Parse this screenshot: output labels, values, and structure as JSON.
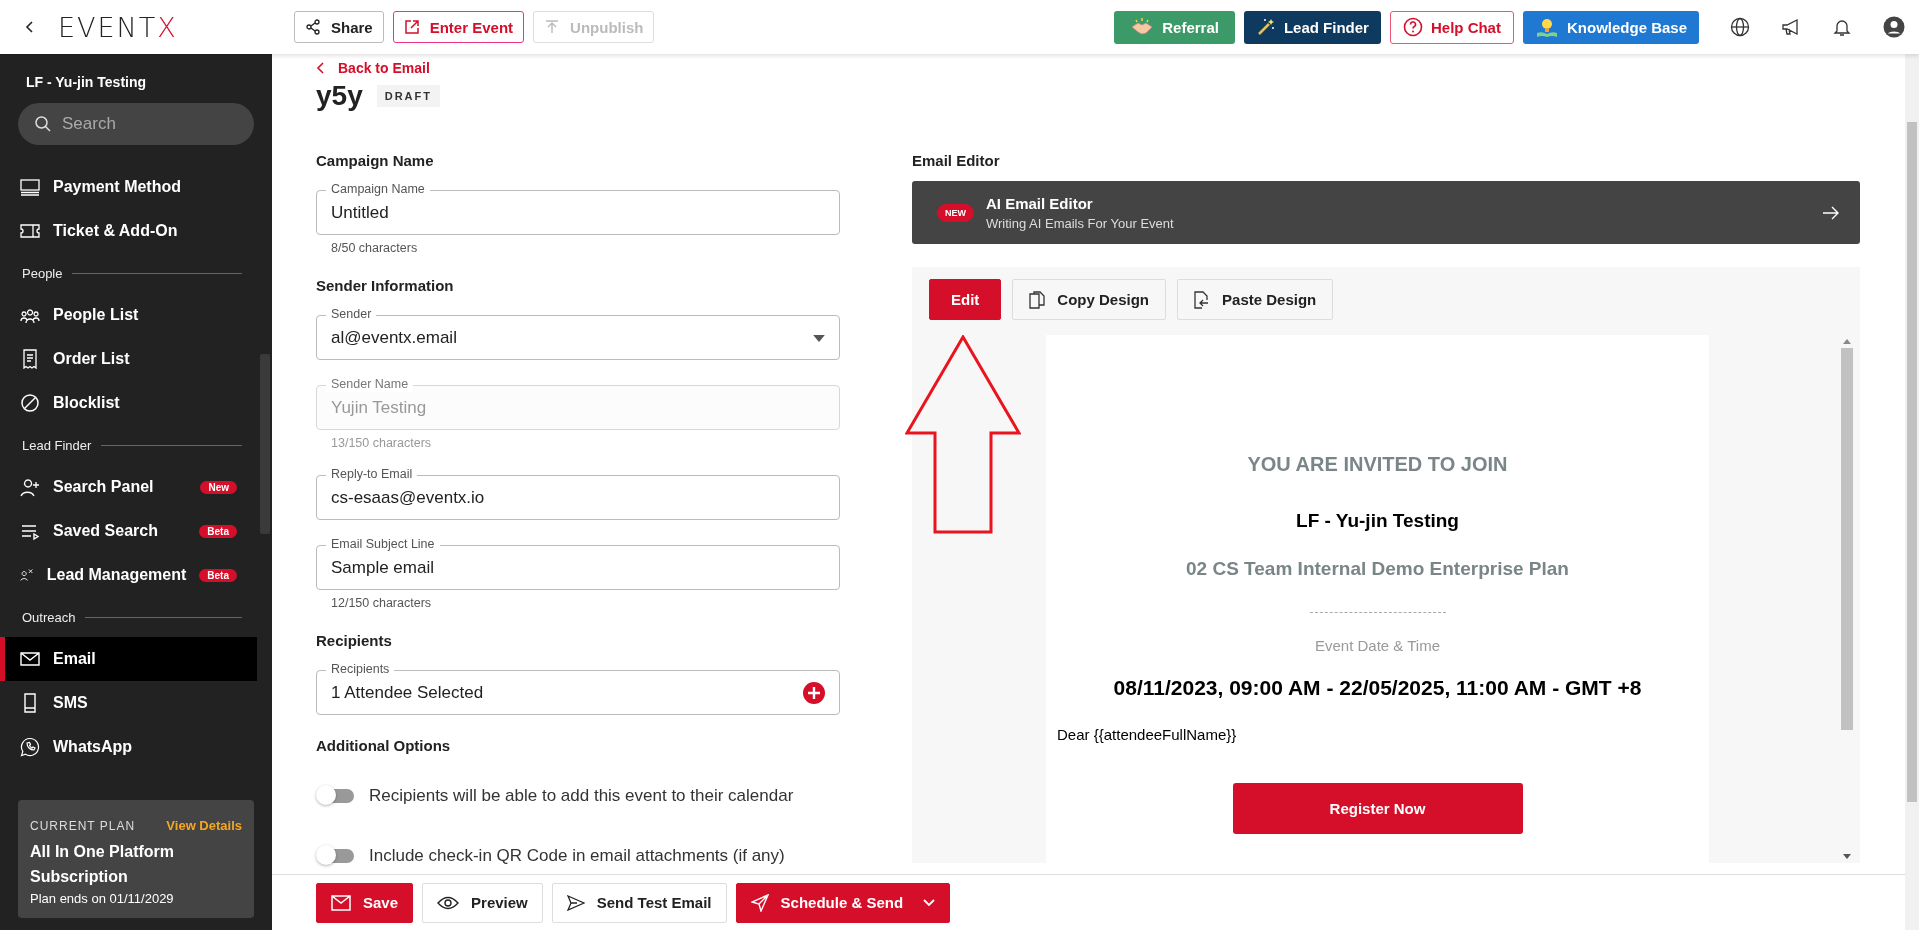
{
  "topbar": {
    "logo": {
      "main": "EVENT",
      "accent": "X"
    },
    "left_buttons": [
      {
        "label": "Share",
        "kind": "plain",
        "disabled": false
      },
      {
        "label": "Enter Event",
        "kind": "outline",
        "disabled": false
      },
      {
        "label": "Unpublish",
        "kind": "plain",
        "disabled": true
      }
    ],
    "right_buttons": [
      {
        "label": "Referral",
        "kind": "referral"
      },
      {
        "label": "Lead Finder",
        "kind": "lead"
      },
      {
        "label": "Help Chat",
        "kind": "help"
      },
      {
        "label": "Knowledge Base",
        "kind": "knowledge"
      }
    ]
  },
  "sidebar": {
    "event_name": "LF - Yu-jin Testing",
    "search": {
      "placeholder": "Search"
    },
    "items": [
      {
        "kind": "item",
        "label": "Payment Method",
        "selected": false
      },
      {
        "kind": "item",
        "label": "Ticket & Add-On",
        "selected": false
      },
      {
        "kind": "section",
        "label": "People"
      },
      {
        "kind": "item",
        "label": "People List",
        "selected": false
      },
      {
        "kind": "item",
        "label": "Order List",
        "selected": false
      },
      {
        "kind": "item",
        "label": "Blocklist",
        "selected": false
      },
      {
        "kind": "section",
        "label": "Lead Finder"
      },
      {
        "kind": "item",
        "label": "Search Panel",
        "badge": "New",
        "selected": false
      },
      {
        "kind": "item",
        "label": "Saved Search",
        "badge": "Beta",
        "selected": false
      },
      {
        "kind": "item",
        "label": "Lead Management",
        "badge": "Beta",
        "selected": false
      },
      {
        "kind": "section",
        "label": "Outreach"
      },
      {
        "kind": "item",
        "label": "Email",
        "selected": true
      },
      {
        "kind": "item",
        "label": "SMS",
        "selected": false
      },
      {
        "kind": "item",
        "label": "WhatsApp",
        "selected": false
      }
    ],
    "plan": {
      "caption": "CURRENT PLAN",
      "link": "View Details",
      "name": "All In One Platform Subscription",
      "ends": "Plan ends on 01/11/2029"
    }
  },
  "page": {
    "back_link": "Back to Email",
    "title": "y5y",
    "status": "DRAFT"
  },
  "form": {
    "sections": [
      {
        "heading": "Campaign Name",
        "fields": [
          {
            "label": "Campaign Name",
            "value": "Untitled",
            "kind": "text",
            "disabled": false,
            "counter": "8/50 characters"
          }
        ]
      },
      {
        "heading": "Sender Information",
        "fields": [
          {
            "label": "Sender",
            "value": "al@eventx.email",
            "kind": "select",
            "disabled": false
          },
          {
            "label": "Sender Name",
            "value": "Yujin Testing",
            "kind": "text",
            "disabled": true,
            "counter": "13/150 characters"
          },
          {
            "label": "Reply-to Email",
            "value": "cs-esaas@eventx.io",
            "kind": "text",
            "disabled": false
          },
          {
            "label": "Email Subject Line",
            "value": "Sample email",
            "kind": "text",
            "disabled": false,
            "counter": "12/150 characters"
          }
        ]
      },
      {
        "heading": "Recipients",
        "fields": [
          {
            "label": "Recipients",
            "value": "1 Attendee Selected",
            "kind": "add",
            "disabled": false
          }
        ]
      }
    ],
    "options_heading": "Additional Options",
    "options": [
      {
        "label": "Recipients will be able to add this event to their calendar",
        "on": false
      },
      {
        "label": "Include check-in QR Code in email attachments (if any)",
        "on": false
      }
    ]
  },
  "editor": {
    "heading": "Email Editor",
    "ai_banner": {
      "badge": "NEW",
      "title": "AI Email Editor",
      "subtitle": "Writing AI Emails For Your Event"
    },
    "tools": [
      {
        "label": "Edit",
        "kind": "primary"
      },
      {
        "label": "Copy Design",
        "kind": "copy"
      },
      {
        "label": "Paste Design",
        "kind": "paste"
      }
    ],
    "preview": {
      "invite": "YOU ARE INVITED TO JOIN",
      "event": "LF - Yu-jin Testing",
      "plan": "02 CS Team Internal Demo Enterprise Plan",
      "date_caption": "Event Date & Time",
      "date": "08/11/2023, 09:00 AM - 22/05/2025, 11:00 AM - GMT +8",
      "greeting": "Dear {{attendeeFullName}}",
      "cta": "Register Now"
    }
  },
  "bottom_bar": [
    {
      "label": "Save",
      "kind": "save"
    },
    {
      "label": "Preview",
      "kind": "preview"
    },
    {
      "label": "Send Test Email",
      "kind": "test"
    },
    {
      "label": "Schedule & Send",
      "kind": "schedule"
    }
  ]
}
